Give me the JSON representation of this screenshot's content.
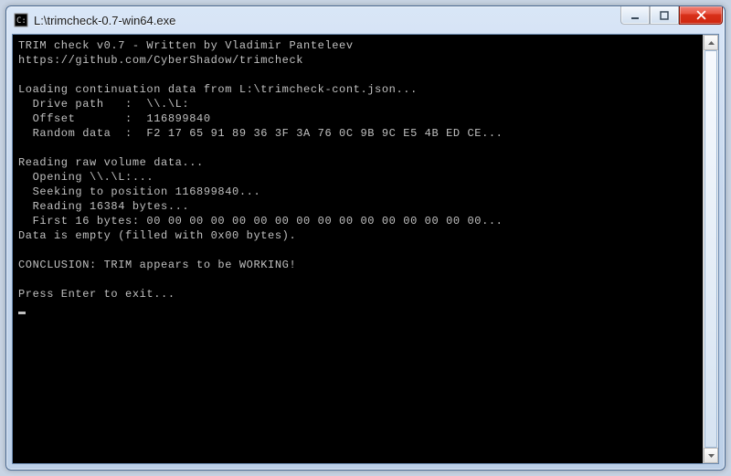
{
  "window": {
    "title": "L:\\trimcheck-0.7-win64.exe"
  },
  "console": {
    "header1": "TRIM check v0.7 - Written by Vladimir Panteleev",
    "header2": "https://github.com/CyberShadow/trimcheck",
    "loading": "Loading continuation data from L:\\trimcheck-cont.json...",
    "drive_path": "  Drive path   :  \\\\.\\L:",
    "offset": "  Offset       :  116899840",
    "random_data": "  Random data  :  F2 17 65 91 89 36 3F 3A 76 0C 9B 9C E5 4B ED CE...",
    "reading": "Reading raw volume data...",
    "opening": "  Opening \\\\.\\L:...",
    "seeking": "  Seeking to position 116899840...",
    "read_bytes": "  Reading 16384 bytes...",
    "first16": "  First 16 bytes: 00 00 00 00 00 00 00 00 00 00 00 00 00 00 00 00...",
    "empty": "Data is empty (filled with 0x00 bytes).",
    "conclusion": "CONCLUSION: TRIM appears to be WORKING!",
    "press_enter": "Press Enter to exit..."
  }
}
